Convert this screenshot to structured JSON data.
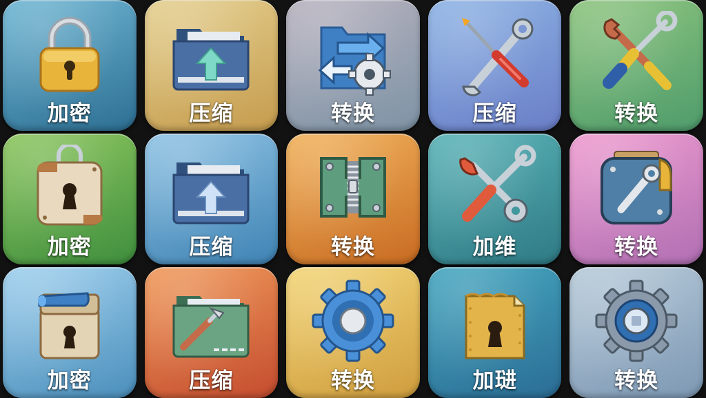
{
  "tiles": [
    {
      "label": "加密",
      "icon": "padlock-icon",
      "color": "#4f93b5"
    },
    {
      "label": "压缩",
      "icon": "folder-upload-icon",
      "color": "#d6b46b"
    },
    {
      "label": "转换",
      "icon": "folder-gear-arrows-icon",
      "color": "#9ea4b1"
    },
    {
      "label": "压缩",
      "icon": "crossed-tools-icon",
      "color": "#7b97d4"
    },
    {
      "label": "转换",
      "icon": "wrench-screwdriver-icon",
      "color": "#6db076"
    },
    {
      "label": "加密",
      "icon": "parchment-lock-icon",
      "color": "#68aa50"
    },
    {
      "label": "压缩",
      "icon": "folder-upload-icon",
      "color": "#62a4cc"
    },
    {
      "label": "转换",
      "icon": "zipper-bracket-icon",
      "color": "#de8e3f"
    },
    {
      "label": "加维",
      "icon": "crossed-tools-icon",
      "color": "#41979e"
    },
    {
      "label": "转换",
      "icon": "toolbox-wrench-icon",
      "color": "#ce85c1"
    },
    {
      "label": "加密",
      "icon": "crate-lock-icon",
      "color": "#72afd5"
    },
    {
      "label": "压缩",
      "icon": "folder-tools-icon",
      "color": "#dc7545"
    },
    {
      "label": "转换",
      "icon": "gear-icon",
      "color": "#e2ba5a"
    },
    {
      "label": "加琎",
      "icon": "vault-lock-icon",
      "color": "#388aaa"
    },
    {
      "label": "转换",
      "icon": "gear-icon",
      "color": "#9ab1c7"
    }
  ]
}
